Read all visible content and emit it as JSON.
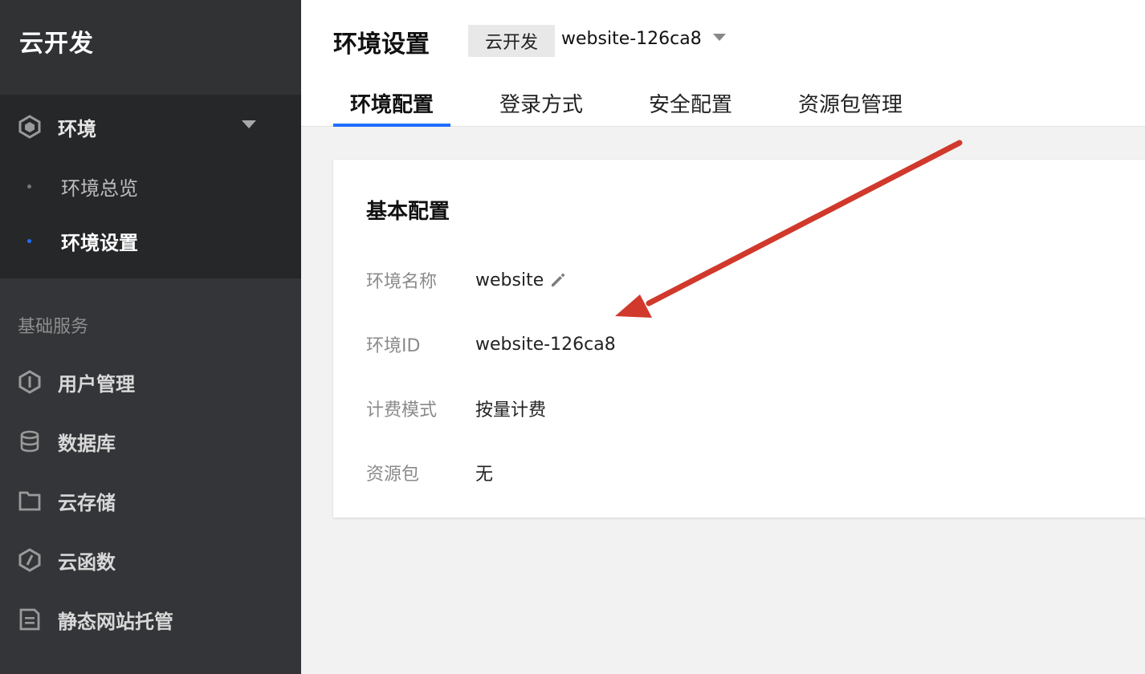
{
  "sidebar": {
    "brand": "云开发",
    "env_group": {
      "label": "环境",
      "icon": "hexagon-icon",
      "children": [
        {
          "label": "环境总览",
          "active": false
        },
        {
          "label": "环境设置",
          "active": true
        }
      ]
    },
    "section_label": "基础服务",
    "items": [
      {
        "label": "用户管理",
        "icon": "user-management-icon"
      },
      {
        "label": "数据库",
        "icon": "database-icon"
      },
      {
        "label": "云存储",
        "icon": "folder-icon"
      },
      {
        "label": "云函数",
        "icon": "function-icon"
      },
      {
        "label": "静态网站托管",
        "icon": "static-site-icon"
      }
    ]
  },
  "header": {
    "title": "环境设置",
    "env_tag": "云开发",
    "env_selected": "website-126ca8"
  },
  "tabs": [
    {
      "label": "环境配置",
      "active": true
    },
    {
      "label": "登录方式",
      "active": false
    },
    {
      "label": "安全配置",
      "active": false
    },
    {
      "label": "资源包管理",
      "active": false
    }
  ],
  "card": {
    "title": "基本配置",
    "rows": [
      {
        "key": "环境名称",
        "value": "website",
        "editable": true
      },
      {
        "key": "环境ID",
        "value": "website-126ca8"
      },
      {
        "key": "计费模式",
        "value": "按量计费"
      },
      {
        "key": "资源包",
        "value": "无"
      }
    ]
  },
  "colors": {
    "sidebar_bg": "#333538",
    "sidebar_active_block": "#262729",
    "accent": "#1e6fff",
    "annotation_arrow": "#d0392b"
  }
}
